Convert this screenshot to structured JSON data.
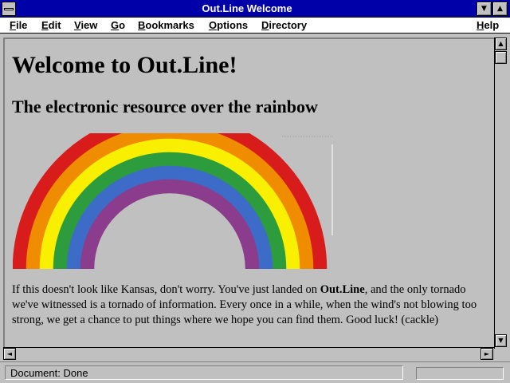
{
  "window": {
    "title": "Out.Line Welcome"
  },
  "menubar": {
    "items": [
      {
        "label": "File",
        "mnemonic": "F",
        "rest": "ile"
      },
      {
        "label": "Edit",
        "mnemonic": "E",
        "rest": "dit"
      },
      {
        "label": "View",
        "mnemonic": "V",
        "rest": "iew"
      },
      {
        "label": "Go",
        "mnemonic": "G",
        "rest": "o"
      },
      {
        "label": "Bookmarks",
        "mnemonic": "B",
        "rest": "ookmarks"
      },
      {
        "label": "Options",
        "mnemonic": "O",
        "rest": "ptions"
      },
      {
        "label": "Directory",
        "mnemonic": "D",
        "rest": "irectory"
      },
      {
        "label": "Help",
        "mnemonic": "H",
        "rest": "elp"
      }
    ]
  },
  "page": {
    "heading": "Welcome to Out.Line!",
    "subheading": "The electronic resource over the rainbow",
    "intro_before": "If this doesn't look like Kansas, don't worry. You've just landed on ",
    "intro_bold": "Out.Line",
    "intro_after": ", and the only tornado we've witnessed is a tornado of information. Every once in a while, when the wind's not blowing too strong, we get a chance to put things where we hope you can find them. Good luck! (cackle)",
    "rainbow_colors": [
      "#d81c1c",
      "#f08c00",
      "#f8f000",
      "#2c9c3c",
      "#3c6cc8",
      "#8c3c8c"
    ]
  },
  "status": {
    "text": "Document: Done"
  },
  "icons": {
    "scroll_up": "▲",
    "scroll_down": "▼",
    "scroll_left": "◄",
    "scroll_right": "►",
    "minimize": "▼",
    "maximize": "▲"
  }
}
